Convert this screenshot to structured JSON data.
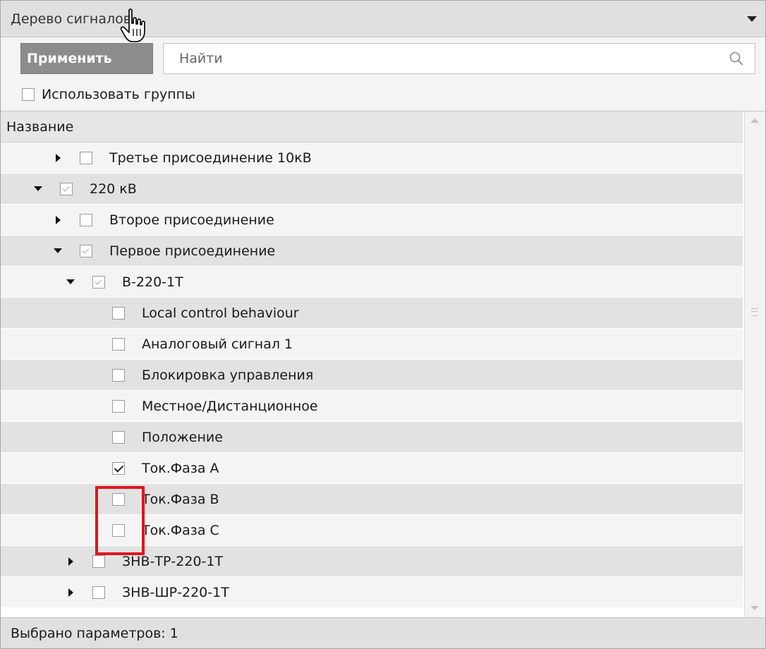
{
  "panel": {
    "title": "Дерево сигналов",
    "collapse_icon": "triangle-down-icon"
  },
  "toolbar": {
    "apply_label": "Применить",
    "search_placeholder": "Найти",
    "search_icon": "search-icon"
  },
  "groups": {
    "label": "Использовать группы",
    "checked": false
  },
  "tree": {
    "column_header": "Название",
    "rows": [
      {
        "label": "Третье присоединение 10кВ",
        "level": 1,
        "expander": "collapsed",
        "check": "unchecked"
      },
      {
        "label": "220 кВ",
        "level": 0,
        "expander": "expanded",
        "check": "partial"
      },
      {
        "label": "Второе присоединение",
        "level": 1,
        "expander": "collapsed",
        "check": "unchecked"
      },
      {
        "label": "Первое присоединение",
        "level": 1,
        "expander": "expanded",
        "check": "partial"
      },
      {
        "label": "В-220-1Т",
        "level": 2,
        "expander": "expanded",
        "check": "partial"
      },
      {
        "label": "Local control behaviour",
        "level": 3,
        "expander": "none",
        "check": "unchecked"
      },
      {
        "label": "Аналоговый сигнал 1",
        "level": 3,
        "expander": "none",
        "check": "unchecked"
      },
      {
        "label": "Блокировка управления",
        "level": 3,
        "expander": "none",
        "check": "unchecked"
      },
      {
        "label": "Местное/Дистанционное",
        "level": 3,
        "expander": "none",
        "check": "unchecked"
      },
      {
        "label": "Положение",
        "level": 3,
        "expander": "none",
        "check": "unchecked"
      },
      {
        "label": "Ток.Фаза А",
        "level": 3,
        "expander": "none",
        "check": "checked"
      },
      {
        "label": "Ток.Фаза В",
        "level": 3,
        "expander": "none",
        "check": "unchecked"
      },
      {
        "label": "Ток.Фаза С",
        "level": 3,
        "expander": "none",
        "check": "unchecked"
      },
      {
        "label": "ЗНВ-ТР-220-1Т",
        "level": 2,
        "expander": "collapsed",
        "check": "unchecked"
      },
      {
        "label": "ЗНВ-ШР-220-1Т",
        "level": 2,
        "expander": "collapsed",
        "check": "unchecked"
      }
    ]
  },
  "status": {
    "text": "Выбрано параметров: 1"
  },
  "colors": {
    "highlight": "#e0141e",
    "apply_button": "#8c8c8c"
  }
}
